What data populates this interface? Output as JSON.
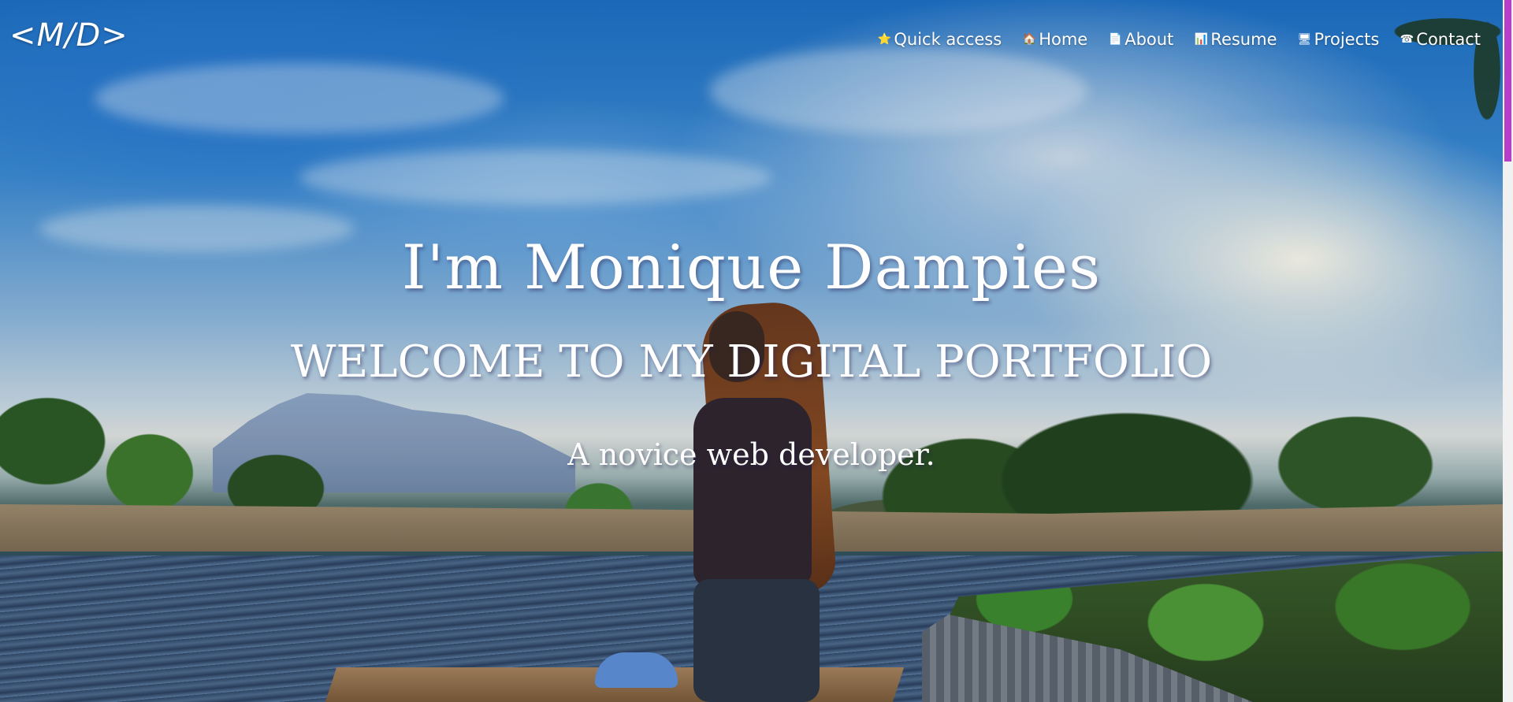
{
  "logo": {
    "text": "<M/D>"
  },
  "nav": {
    "items": [
      {
        "label": "Quick access",
        "icon": "⭐"
      },
      {
        "label": "Home",
        "icon": "🏠"
      },
      {
        "label": "About",
        "icon": "📄"
      },
      {
        "label": "Resume",
        "icon": "📊"
      },
      {
        "label": "Projects",
        "icon": "🖥"
      },
      {
        "label": "Contact",
        "icon": "☎"
      }
    ]
  },
  "hero": {
    "title": "I'm Monique Dampies",
    "subtitle": "WELCOME TO MY DIGITAL PORTFOLIO",
    "tagline": "A novice web developer."
  },
  "colors": {
    "text": "#ffffff",
    "scroll_thumb": "#b63ec9"
  }
}
